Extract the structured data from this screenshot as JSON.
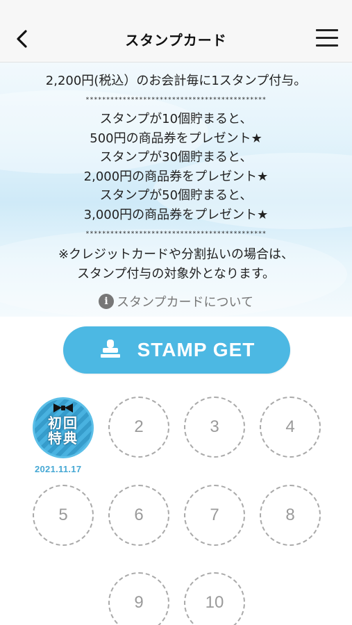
{
  "header": {
    "title": "スタンプカード"
  },
  "info": {
    "rule": "2,200円(税込）のお会計毎に1スタンプ付与。",
    "separator": "********************************************",
    "rewards": [
      "スタンプが10個貯まると、",
      "500円の商品券をプレゼント★",
      "スタンプが30個貯まると、",
      "2,000円の商品券をプレゼント★",
      "スタンプが50個貯まると、",
      "3,000円の商品券をプレゼント★"
    ],
    "notes": [
      "※クレジットカードや分割払いの場合は、",
      "スタンプ付与の対象外となります。"
    ],
    "about_link": "スタンプカードについて"
  },
  "stamp_button": {
    "label": "STAMP GET"
  },
  "stamps": {
    "first": {
      "text_line1": "初回",
      "text_line2": "特典",
      "date": "2021.11.17"
    },
    "slots": [
      "2",
      "3",
      "4",
      "5",
      "6",
      "7",
      "8",
      "9",
      "10"
    ]
  },
  "colors": {
    "accent": "#4cb8e3",
    "date": "#46a8d4",
    "slot_border": "#a9a9a9"
  }
}
